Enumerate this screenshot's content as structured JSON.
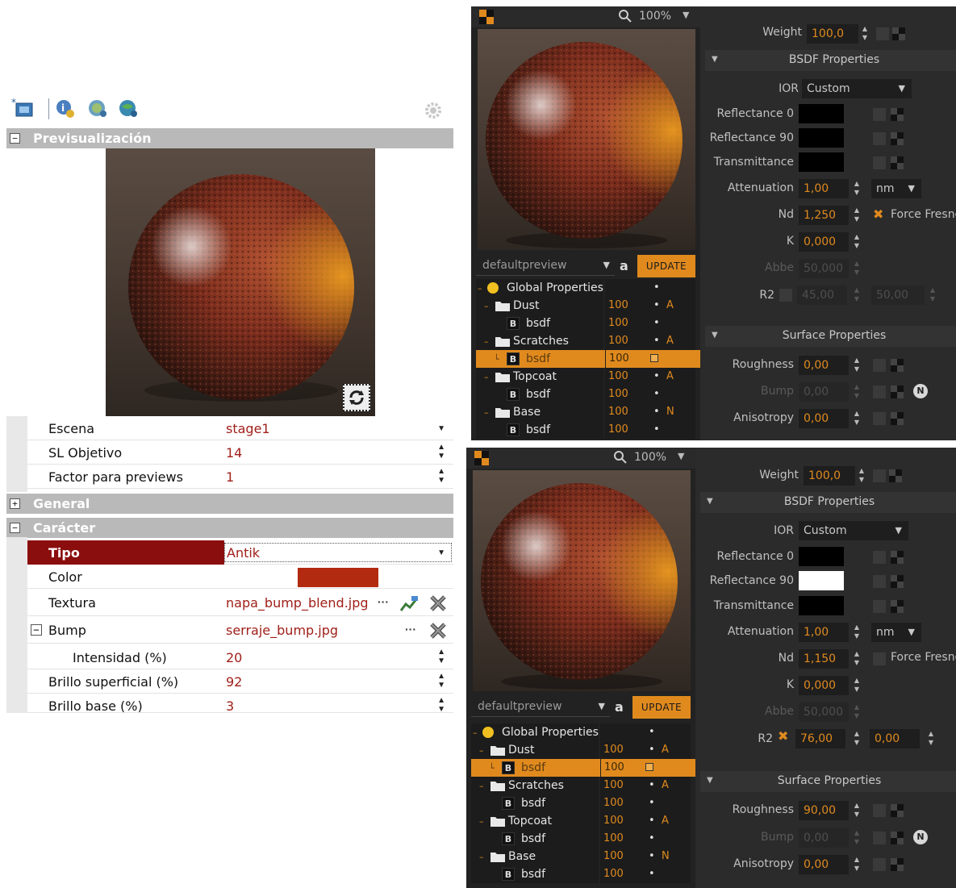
{
  "left": {
    "sections": {
      "preview": "Previsualización",
      "general": "General",
      "caracter": "Carácter",
      "preview_toggle": "−",
      "general_toggle": "+",
      "caracter_toggle": "−"
    },
    "preview_rows": [
      {
        "label": "Escena",
        "value": "stage1"
      },
      {
        "label": "SL Objetivo",
        "value": "14"
      },
      {
        "label": "Factor para previews",
        "value": "1"
      }
    ],
    "character_rows": {
      "tipo": {
        "label": "Tipo",
        "value": "Antik"
      },
      "color": {
        "label": "Color",
        "value": "#b22a0f"
      },
      "textura": {
        "label": "Textura",
        "value": "napa_bump_blend.jpg",
        "more": "···"
      },
      "bump": {
        "label": "Bump",
        "value": "serraje_bump.jpg",
        "more": "···",
        "toggle": "−"
      },
      "intensidad": {
        "label": "Intensidad (%)",
        "value": "20"
      },
      "brillo_sup": {
        "label": "Brillo superficial (%)",
        "value": "92"
      },
      "brillo_base": {
        "label": "Brillo base (%)",
        "value": "3"
      }
    }
  },
  "panel_top": {
    "zoom": "100%",
    "preset": "defaultpreview",
    "update": "UPDATE",
    "tree": [
      {
        "name": "Global Properties",
        "val": "",
        "flag": ""
      },
      {
        "name": "Dust",
        "val": "100",
        "flag": "A"
      },
      {
        "name": "bsdf",
        "val": "100",
        "flag": ""
      },
      {
        "name": "Scratches",
        "val": "100",
        "flag": "A"
      },
      {
        "name": "bsdf",
        "val": "100",
        "flag": ""
      },
      {
        "name": "Topcoat",
        "val": "100",
        "flag": "A"
      },
      {
        "name": "bsdf",
        "val": "100",
        "flag": ""
      },
      {
        "name": "Base",
        "val": "100",
        "flag": "N"
      },
      {
        "name": "bsdf",
        "val": "100",
        "flag": ""
      }
    ],
    "weight": {
      "label": "Weight",
      "value": "100,0"
    },
    "bsdf_header": "BSDF Properties",
    "ior": {
      "label": "IOR",
      "value": "Custom"
    },
    "reflectance0": {
      "label": "Reflectance 0",
      "color": "#000000"
    },
    "reflectance90": {
      "label": "Reflectance 90",
      "color": "#000000"
    },
    "transmittance": {
      "label": "Transmittance",
      "color": "#000000"
    },
    "attenuation": {
      "label": "Attenuation",
      "value": "1,00",
      "unit": "nm"
    },
    "nd": {
      "label": "Nd",
      "value": "1,250",
      "force": "Force Fresnel",
      "force_checked": true
    },
    "k": {
      "label": "K",
      "value": "0,000"
    },
    "abbe": {
      "label": "Abbe",
      "value": "50,000"
    },
    "r2": {
      "label": "R2",
      "value": "45,00",
      "value2": "50,00",
      "checked": false
    },
    "surface_header": "Surface Properties",
    "roughness": {
      "label": "Roughness",
      "value": "0,00"
    },
    "bump": {
      "label": "Bump",
      "value": "0,00"
    },
    "anisotropy": {
      "label": "Anisotropy",
      "value": "0,00"
    }
  },
  "panel_bottom": {
    "zoom": "100%",
    "preset": "defaultpreview",
    "update": "UPDATE",
    "tree": [
      {
        "name": "Global Properties",
        "val": "",
        "flag": ""
      },
      {
        "name": "Dust",
        "val": "100",
        "flag": "A"
      },
      {
        "name": "bsdf",
        "val": "100",
        "flag": ""
      },
      {
        "name": "Scratches",
        "val": "100",
        "flag": "A"
      },
      {
        "name": "bsdf",
        "val": "100",
        "flag": ""
      },
      {
        "name": "Topcoat",
        "val": "100",
        "flag": "A"
      },
      {
        "name": "bsdf",
        "val": "100",
        "flag": ""
      },
      {
        "name": "Base",
        "val": "100",
        "flag": "N"
      },
      {
        "name": "bsdf",
        "val": "100",
        "flag": ""
      }
    ],
    "weight": {
      "label": "Weight",
      "value": "100,0"
    },
    "bsdf_header": "BSDF Properties",
    "ior": {
      "label": "IOR",
      "value": "Custom"
    },
    "reflectance0": {
      "label": "Reflectance 0",
      "color": "#000000"
    },
    "reflectance90": {
      "label": "Reflectance 90",
      "color": "#ffffff"
    },
    "transmittance": {
      "label": "Transmittance",
      "color": "#000000"
    },
    "attenuation": {
      "label": "Attenuation",
      "value": "1,00",
      "unit": "nm"
    },
    "nd": {
      "label": "Nd",
      "value": "1,150",
      "force": "Force Fresnel",
      "force_checked": false
    },
    "k": {
      "label": "K",
      "value": "0,000"
    },
    "abbe": {
      "label": "Abbe",
      "value": "50,000"
    },
    "r2": {
      "label": "R2",
      "value": "76,00",
      "value2": "0,00",
      "checked": true
    },
    "surface_header": "Surface Properties",
    "roughness": {
      "label": "Roughness",
      "value": "90,00"
    },
    "bump": {
      "label": "Bump",
      "value": "0,00"
    },
    "anisotropy": {
      "label": "Anisotropy",
      "value": "0,00"
    }
  }
}
